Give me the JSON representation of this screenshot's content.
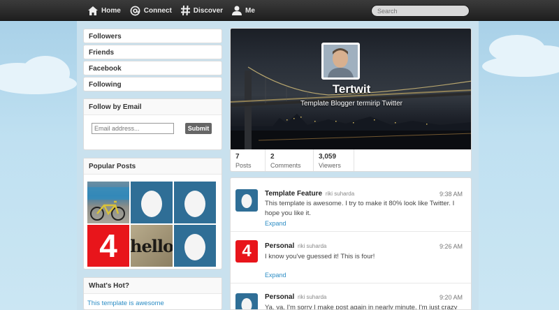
{
  "topbar": {
    "nav": [
      {
        "label": "Home",
        "icon": "home-icon"
      },
      {
        "label": "Connect",
        "icon": "at-icon"
      },
      {
        "label": "Discover",
        "icon": "hash-icon"
      },
      {
        "label": "Me",
        "icon": "person-icon"
      }
    ],
    "search_placeholder": "Search"
  },
  "sidebar": {
    "menu": [
      "Followers",
      "Friends",
      "Facebook",
      "Following"
    ],
    "follow_email": {
      "title": "Follow by Email",
      "placeholder": "Email address...",
      "submit": "Submit"
    },
    "popular": {
      "title": "Popular Posts"
    },
    "hot": {
      "title": "What's Hot?",
      "item": "This template is awesome"
    }
  },
  "profile": {
    "name": "Tertwit",
    "bio": "Template Blogger termirip Twitter",
    "stats": [
      {
        "value": "7",
        "label": "Posts"
      },
      {
        "value": "2",
        "label": "Comments"
      },
      {
        "value": "3,059",
        "label": "Viewers"
      }
    ]
  },
  "posts": [
    {
      "title": "Template Feature",
      "author": "riki suharda",
      "time": "9:38 AM",
      "body": "This template is awesome. I try to make it 80% look like Twitter. I hope you like it.",
      "expand": "Expand"
    },
    {
      "title": "Personal",
      "author": "riki suharda",
      "time": "9:26 AM",
      "body": "I know you've guessed it! This is four!",
      "expand": "Expand"
    },
    {
      "title": "Personal",
      "author": "riki suharda",
      "time": "9:20 AM",
      "body": "Ya, ya. I'm sorry I make post again in nearly minute. I'm just crazy",
      "expand": ""
    }
  ],
  "thumb_texts": {
    "four": "4",
    "hello": "hello"
  },
  "colors": {
    "topbar": "#2c2c2c",
    "link": "#2b8cc4",
    "egg_bg": "#2f6e96",
    "red": "#e8151b"
  }
}
